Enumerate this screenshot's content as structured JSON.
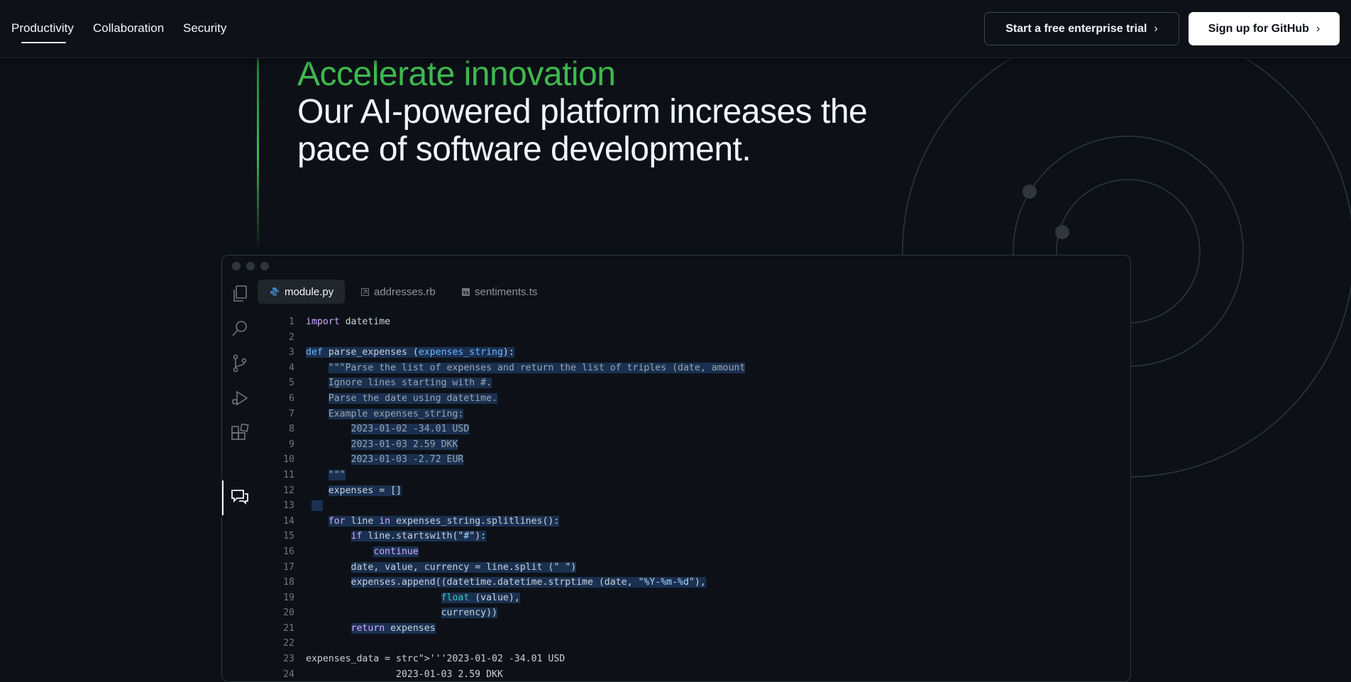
{
  "nav": {
    "items": [
      "Productivity",
      "Collaboration",
      "Security"
    ],
    "active_index": 0,
    "cta_outline": "Start a free enterprise trial",
    "cta_solid": "Sign up for GitHub"
  },
  "hero": {
    "eyebrow": "Accelerate innovation",
    "line1": "Our AI-powered platform increases the",
    "line2": "pace of software development."
  },
  "editor": {
    "tabs": [
      {
        "label": "module.py",
        "icon": "python-icon",
        "active": true
      },
      {
        "label": "addresses.rb",
        "icon": "ruby-file-icon",
        "active": false
      },
      {
        "label": "sentiments.ts",
        "icon": "typescript-file-icon",
        "active": false
      }
    ],
    "activity_icons": [
      "files-icon",
      "search-icon",
      "source-control-icon",
      "run-debug-icon",
      "extensions-icon",
      "chat-icon"
    ],
    "code_lines": [
      "import datetime",
      "",
      "def parse_expenses (expenses_string):",
      "    \"\"\"Parse the list of expenses and return the list of triples (date, amount",
      "    Ignore lines starting with #.",
      "    Parse the date using datetime.",
      "    Example expenses_string:",
      "        2023-01-02 -34.01 USD",
      "        2023-01-03 2.59 DKK",
      "        2023-01-03 -2.72 EUR",
      "    \"\"\"",
      "    expenses = []",
      "",
      "    for line in expenses_string.splitlines():",
      "        if line.startswith(\"#\"):",
      "            continue",
      "        date, value, currency = line.split (\" \")",
      "        expenses.append((datetime.datetime.strptime (date, \"%Y-%m-%d\"),",
      "                        float (value),",
      "                        currency))",
      "        return expenses",
      "",
      "expenses_data = '''2023-01-02 -34.01 USD",
      "                2023-01-03 2.59 DKK"
    ]
  }
}
